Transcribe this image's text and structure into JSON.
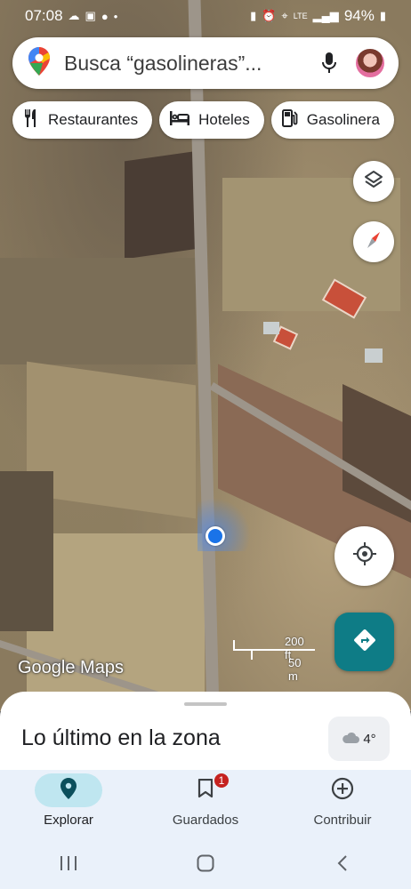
{
  "status_bar": {
    "time": "07:08",
    "battery": "94%",
    "network": "LTE"
  },
  "search": {
    "placeholder": "Busca “gasolineras”..."
  },
  "chips": [
    {
      "label": "Restaurantes",
      "icon": "fork-knife-icon"
    },
    {
      "label": "Hoteles",
      "icon": "bed-icon"
    },
    {
      "label": "Gasolinera",
      "icon": "gas-station-icon"
    }
  ],
  "map": {
    "logo": "Google Maps",
    "scale_ft": "200 ft",
    "scale_m": "50 m"
  },
  "sheet": {
    "title": "Lo último en la zona",
    "weather_temp": "4°"
  },
  "nav": {
    "items": [
      {
        "label": "Explorar",
        "icon": "location-pin-icon",
        "active": true
      },
      {
        "label": "Guardados",
        "icon": "bookmark-icon",
        "badge": "1"
      },
      {
        "label": "Contribuir",
        "icon": "add-circle-icon"
      }
    ]
  },
  "colors": {
    "accent": "#0e7c86",
    "location": "#1a73e8",
    "badge": "#c5221f"
  }
}
